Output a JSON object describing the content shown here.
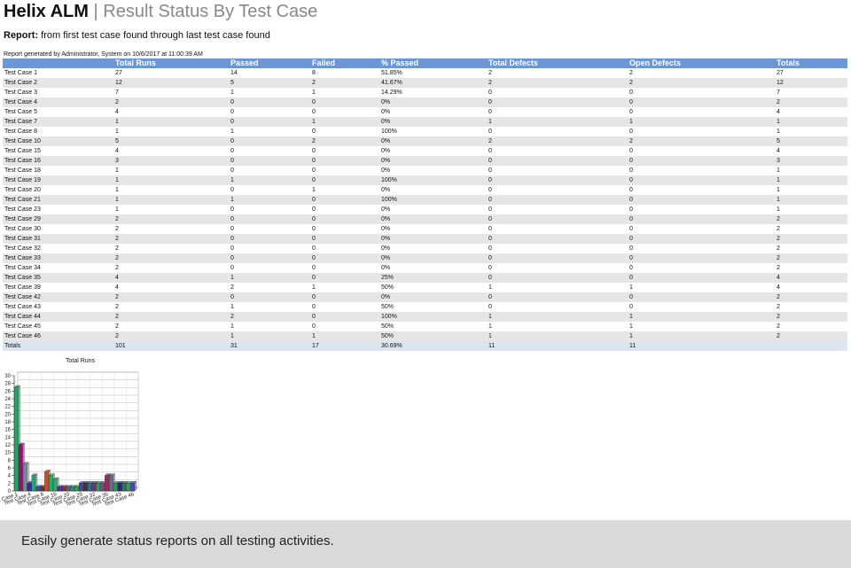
{
  "header": {
    "brand": "Helix ALM",
    "separator": "|",
    "subtitle": "Result Status By Test Case"
  },
  "report": {
    "label": "Report:",
    "text": "from first test case found through last test case found"
  },
  "generated": "Report generated by Administrator, System on 10/6/2017 at 11:00:39 AM",
  "table": {
    "columns": [
      "",
      "Total Runs",
      "Passed",
      "Failed",
      "% Passed",
      "Total Defects",
      "Open Defects",
      "Totals"
    ],
    "rows": [
      [
        "Test Case 1",
        "27",
        "14",
        "8",
        "51.85%",
        "2",
        "2",
        "27"
      ],
      [
        "Test Case 2",
        "12",
        "5",
        "2",
        "41.67%",
        "2",
        "2",
        "12"
      ],
      [
        "Test Case 3",
        "7",
        "1",
        "1",
        "14.29%",
        "0",
        "0",
        "7"
      ],
      [
        "Test Case 4",
        "2",
        "0",
        "0",
        "0%",
        "0",
        "0",
        "2"
      ],
      [
        "Test Case 5",
        "4",
        "0",
        "0",
        "0%",
        "0",
        "0",
        "4"
      ],
      [
        "Test Case 7",
        "1",
        "0",
        "1",
        "0%",
        "1",
        "1",
        "1"
      ],
      [
        "Test Case 8",
        "1",
        "1",
        "0",
        "100%",
        "0",
        "0",
        "1"
      ],
      [
        "Test Case 10",
        "5",
        "0",
        "2",
        "0%",
        "2",
        "2",
        "5"
      ],
      [
        "Test Case 15",
        "4",
        "0",
        "0",
        "0%",
        "0",
        "0",
        "4"
      ],
      [
        "Test Case 16",
        "3",
        "0",
        "0",
        "0%",
        "0",
        "0",
        "3"
      ],
      [
        "Test Case 18",
        "1",
        "0",
        "0",
        "0%",
        "0",
        "0",
        "1"
      ],
      [
        "Test Case 19",
        "1",
        "1",
        "0",
        "100%",
        "0",
        "0",
        "1"
      ],
      [
        "Test Case 20",
        "1",
        "0",
        "1",
        "0%",
        "0",
        "0",
        "1"
      ],
      [
        "Test Case 21",
        "1",
        "1",
        "0",
        "100%",
        "0",
        "0",
        "1"
      ],
      [
        "Test Case 23",
        "1",
        "0",
        "0",
        "0%",
        "0",
        "0",
        "1"
      ],
      [
        "Test Case 29",
        "2",
        "0",
        "0",
        "0%",
        "0",
        "0",
        "2"
      ],
      [
        "Test Case 30",
        "2",
        "0",
        "0",
        "0%",
        "0",
        "0",
        "2"
      ],
      [
        "Test Case 31",
        "2",
        "0",
        "0",
        "0%",
        "0",
        "0",
        "2"
      ],
      [
        "Test Case 32",
        "2",
        "0",
        "0",
        "0%",
        "0",
        "0",
        "2"
      ],
      [
        "Test Case 33",
        "2",
        "0",
        "0",
        "0%",
        "0",
        "0",
        "2"
      ],
      [
        "Test Case 34",
        "2",
        "0",
        "0",
        "0%",
        "0",
        "0",
        "2"
      ],
      [
        "Test Case 35",
        "4",
        "1",
        "0",
        "25%",
        "0",
        "0",
        "4"
      ],
      [
        "Test Case 39",
        "4",
        "2",
        "1",
        "50%",
        "1",
        "1",
        "4"
      ],
      [
        "Test Case 42",
        "2",
        "0",
        "0",
        "0%",
        "0",
        "0",
        "2"
      ],
      [
        "Test Case 43",
        "2",
        "1",
        "0",
        "50%",
        "0",
        "0",
        "2"
      ],
      [
        "Test Case 44",
        "2",
        "2",
        "0",
        "100%",
        "1",
        "1",
        "2"
      ],
      [
        "Test Case 45",
        "2",
        "1",
        "0",
        "50%",
        "1",
        "1",
        "2"
      ],
      [
        "Test Case 46",
        "2",
        "1",
        "1",
        "50%",
        "1",
        "1",
        "2"
      ]
    ],
    "totals": [
      "Totals",
      "101",
      "31",
      "17",
      "30.69%",
      "11",
      "11",
      ""
    ]
  },
  "chart_data": {
    "type": "bar",
    "title": "Total Runs",
    "categories": [
      "Test Case 1",
      "Test Case 2",
      "Test Case 3",
      "Test Case 4",
      "Test Case 5",
      "Test Case 7",
      "Test Case 8",
      "Test Case 10",
      "Test Case 15",
      "Test Case 16",
      "Test Case 18",
      "Test Case 19",
      "Test Case 20",
      "Test Case 21",
      "Test Case 23",
      "Test Case 29",
      "Test Case 30",
      "Test Case 31",
      "Test Case 32",
      "Test Case 33",
      "Test Case 34",
      "Test Case 35",
      "Test Case 39",
      "Test Case 42",
      "Test Case 43",
      "Test Case 44",
      "Test Case 45",
      "Test Case 46"
    ],
    "x_tick_labels": [
      "Test Case 1",
      "Test Case 4",
      "Test Case 8",
      "Test Case 16",
      "Test Case 20",
      "Test Case 29",
      "Test Case 32",
      "Test Case 35",
      "Test Case 43",
      "Test Case 46"
    ],
    "values": [
      27,
      12,
      7,
      2,
      4,
      1,
      1,
      5,
      4,
      3,
      1,
      1,
      1,
      1,
      1,
      2,
      2,
      2,
      2,
      2,
      2,
      4,
      4,
      2,
      2,
      2,
      2,
      2
    ],
    "ylim": [
      0,
      30
    ],
    "yticks": [
      0,
      2,
      4,
      6,
      8,
      10,
      12,
      14,
      16,
      18,
      20,
      22,
      24,
      26,
      28,
      30
    ],
    "grid": true,
    "colors": [
      "#1fa865",
      "#8b1a6b",
      "#77879a",
      "#2f2fa0",
      "#2fa07a",
      "#2a5a9a",
      "#7a2a2a",
      "#c8502a",
      "#27b061",
      "#38a37e",
      "#3a3a9e",
      "#8a2c3a",
      "#5f5f7f",
      "#2c8e6f",
      "#27a35b",
      "#4a4a8a",
      "#3a3a3a",
      "#2a6d9a",
      "#6b3a6b",
      "#2f9a64",
      "#7a4a8a",
      "#9c2a5a",
      "#6a6a8a",
      "#2a9a55",
      "#2a2a7a",
      "#2a7a5a",
      "#3a9a6a",
      "#4a4ab0"
    ]
  },
  "banner": {
    "text": "Easily generate status reports on all testing activities."
  }
}
